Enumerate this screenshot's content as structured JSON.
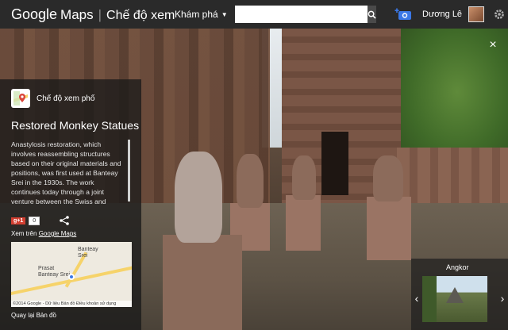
{
  "header": {
    "brand_google": "Google",
    "brand_maps": "Maps",
    "separator": "|",
    "mode_title": "Chế độ xem",
    "explore_label": "Khám phá",
    "search_placeholder": "",
    "user_name": "Dương Lê",
    "icons": {
      "search": "search-icon",
      "camera_add": "add-photo-icon",
      "settings": "gear-icon"
    }
  },
  "close_label": "×",
  "panel": {
    "mode_label": "Chế độ xem phố",
    "title": "Restored Monkey Statues",
    "description": "Anastylosis restoration, which involves reassembling structures based on their original materials and positions, was first used at Banteay Srei in the 1930s. The work continues today through a joint venture between the Swiss and Cambodian",
    "gplus_label": "g+1",
    "gplus_count": "0",
    "see_on_prefix": "Xem trên",
    "see_on_link": "Google Maps",
    "map": {
      "label_top": "Banteay Srei",
      "label_left": "Prasat\nBanteay Srei",
      "footer": "©2014 Google - Dữ liệu Bản đồ    Điều khoản sử dụng"
    },
    "back_to_map": "Quay lại Bản đồ"
  },
  "thumbnail": {
    "label": "Angkor",
    "prev": "‹",
    "next": "›"
  },
  "colors": {
    "topbar_bg": "#2a2a2a",
    "gplus_red": "#d23f31",
    "pin_blue": "#3b78e7"
  }
}
